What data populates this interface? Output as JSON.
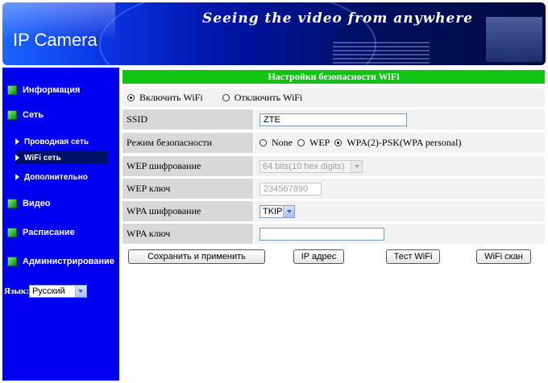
{
  "header": {
    "title": "IP Camera",
    "slogan": "Seeing the video from anywhere"
  },
  "sidebar": {
    "items": [
      {
        "label": "Информация"
      },
      {
        "label": "Сеть"
      },
      {
        "label": "Видео"
      },
      {
        "label": "Расписание"
      },
      {
        "label": "Администрирование"
      }
    ],
    "subitems": [
      {
        "label": "Проводная сеть"
      },
      {
        "label": "WiFi сеть",
        "active": true
      },
      {
        "label": "Дополнительно"
      }
    ],
    "language": {
      "label": "Язык:",
      "selected": "Русский"
    }
  },
  "main": {
    "section_title": "Настройки безопасности WiFi",
    "wifi_enable": {
      "on_label": "Включить WiFi",
      "off_label": "Отключить WiFi",
      "selected": "on"
    },
    "ssid": {
      "label": "SSID",
      "value": "ZTE"
    },
    "security_mode": {
      "label": "Режим безопасности",
      "options": [
        "None",
        "WEP",
        "WPA(2)-PSK(WPA personal)"
      ],
      "selected": "WPA(2)-PSK(WPA personal)"
    },
    "wep_encryption": {
      "label": "WEP шифрование",
      "value": "64 bits(10 hex digits)"
    },
    "wep_key": {
      "label": "WEP ключ",
      "value": "234567890"
    },
    "wpa_encryption": {
      "label": "WPA шифрование",
      "value": "TKIP"
    },
    "wpa_key": {
      "label": "WPA ключ",
      "value": ""
    },
    "buttons": {
      "save": "Сохранить и применить",
      "ip": "IP адрес",
      "test": "Тест WiFi",
      "scan": "WiFi скан"
    }
  },
  "colors": {
    "sidebar_bg": "#0000f0",
    "title_bar": "#11c411",
    "label_bg": "#d8d8d8",
    "value_bg": "#f2f2f2"
  }
}
